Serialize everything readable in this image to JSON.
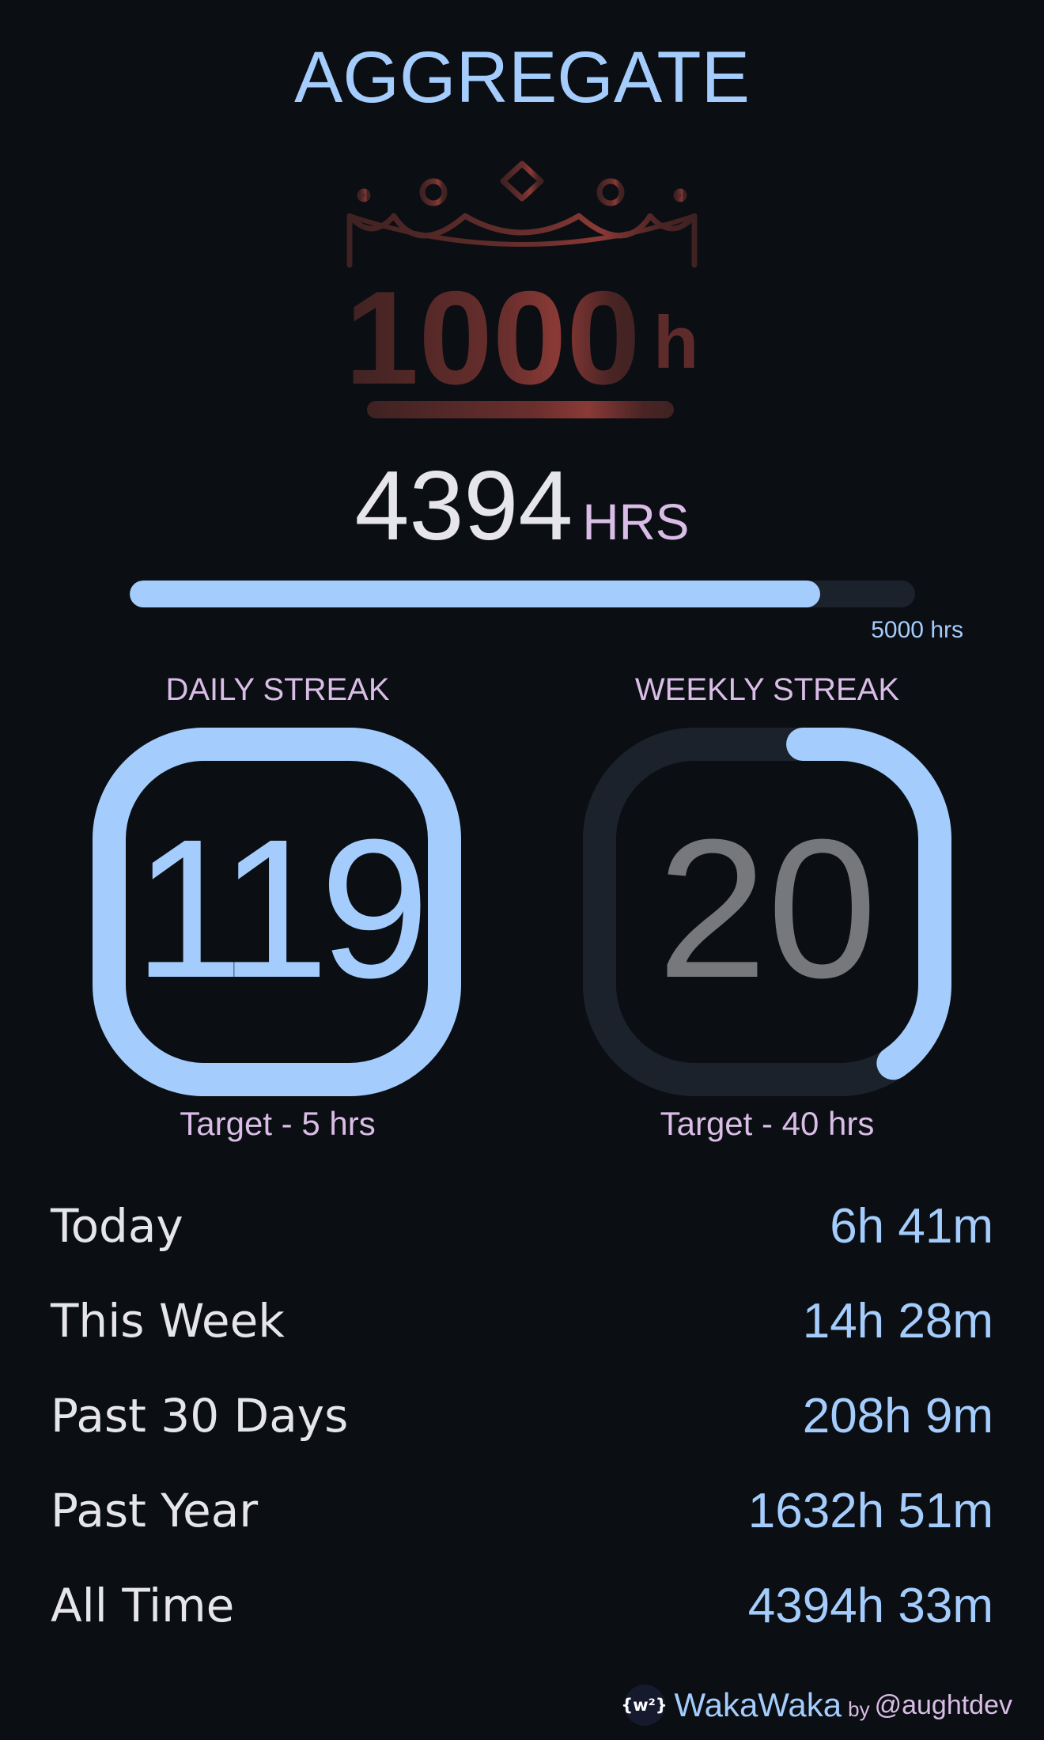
{
  "header": {
    "title": "AGGREGATE"
  },
  "milestone_badge": {
    "value": "1000",
    "unit": "h",
    "icon": "crown-icon"
  },
  "total": {
    "value": "4394",
    "unit": "HRS",
    "goal_label": "5000 hrs",
    "progress_fraction": 0.879
  },
  "daily_streak": {
    "title": "DAILY STREAK",
    "value": "119",
    "target": "Target - 5 hrs",
    "progress_fraction": 1.0
  },
  "weekly_streak": {
    "title": "WEEKLY STREAK",
    "value": "20",
    "target": "Target - 40 hrs",
    "progress_fraction": 0.36
  },
  "stats": [
    {
      "label": "Today",
      "value": "6h 41m"
    },
    {
      "label": "This Week",
      "value": "14h 28m"
    },
    {
      "label": "Past 30 Days",
      "value": "208h 9m"
    },
    {
      "label": "Past Year",
      "value": "1632h 51m"
    },
    {
      "label": "All Time",
      "value": "4394h 33m"
    }
  ],
  "footer": {
    "logo_text": "{w²}",
    "brand": "WakaWaka",
    "by": "by",
    "handle": "@aughtdev"
  },
  "colors": {
    "background": "#0b0e13",
    "accent": "#a4cdfd",
    "label": "#d9bde6",
    "track": "#1b222c",
    "text": "#e6e6ea",
    "muted_number": "#77787c",
    "badge": "#5a2a2c"
  }
}
